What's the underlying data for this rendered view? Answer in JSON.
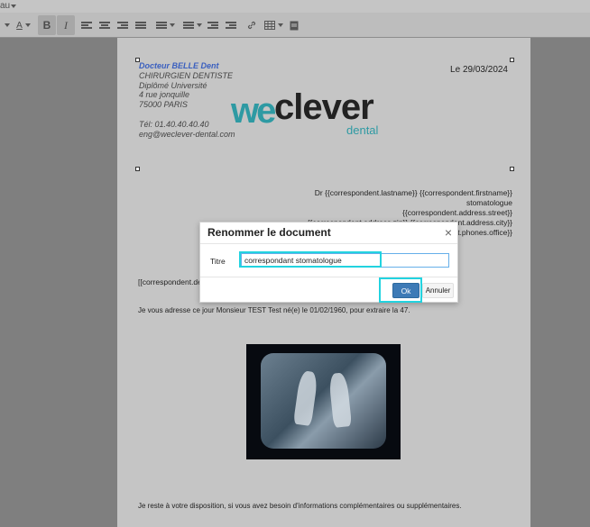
{
  "menu": {
    "fragment_label": "au"
  },
  "toolbar": {
    "bold_label": "B",
    "italic_label": "I",
    "text_color_label": "A"
  },
  "document": {
    "doctor_name": "Docteur BELLE Dent",
    "doctor_lines": [
      "CHIRURGIEN DENTISTE",
      "Diplômé Université",
      "4 rue jonquille",
      "75000  PARIS",
      "",
      "Tél: 01.40.40.40.40",
      "eng@weclever-dental.com"
    ],
    "date": "Le 29/03/2024",
    "logo": {
      "we": "we",
      "clever": "clever",
      "dental": "dental"
    },
    "recipient_lines": [
      "Dr {{correspondent.lastname}} {{correspondent.firstname}}",
      "stomatologue",
      "{{correspondent.address.street}}",
      "{{correspondent.address.zip}} {{correspondent.address.city}}",
      "{{correspondent.phones.office}}"
    ],
    "salutation": "[[correspondent.de",
    "paragraph1": "Je vous adresse ce jour Monsieur TEST Test né(e) le 01/02/1960, pour extraire la 47.",
    "paragraph2": "Je reste à votre disposition, si vous avez besoin d'informations complémentaires ou supplémentaires."
  },
  "dialog": {
    "title": "Renommer le document",
    "close_glyph": "×",
    "field_label": "Titre",
    "field_value": "correspondant stomatologue",
    "ok_label": "Ok",
    "cancel_label": "Annuler"
  },
  "colors": {
    "overlay": "#7f7f7f",
    "doctor_name": "#3a5fbf",
    "logo_accent": "#2e9aa3",
    "ok_button": "#3d7ab6",
    "highlight": "#22d3e0"
  }
}
